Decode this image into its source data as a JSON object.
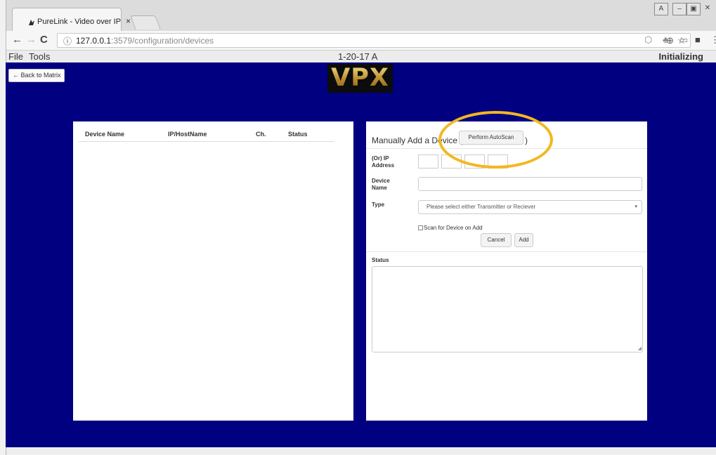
{
  "browser": {
    "tab_title": "PureLink - Video over IP",
    "tab_close": "×",
    "url_host": "127.0.0.1",
    "url_rest": ":3579/configuration/devices",
    "info_icon": "info-icon",
    "window_controls": [
      "A",
      "–",
      "▣",
      "✕"
    ]
  },
  "app": {
    "menu": [
      "File",
      "Tools"
    ],
    "version": "1-20-17 A",
    "state": "Initializing",
    "back_button": "← Back to Matrix",
    "logo": "VPX"
  },
  "device_list": {
    "columns": [
      "Device Name",
      "IP/HostName",
      "Ch.",
      "Status"
    ],
    "rows": []
  },
  "add_device": {
    "title": "Manually Add a Device (Or",
    "autoscan_button": "Perform AutoScan",
    "title_close": ")",
    "ip_label_1": "(Or) IP",
    "ip_label_2": "Address",
    "ip_octets": [
      "",
      "",
      "",
      ""
    ],
    "name_label_1": "Device",
    "name_label_2": "Name",
    "name_value": "",
    "type_label": "Type",
    "type_selected": "Please select either Transmitter or Reciever",
    "scan_checkbox_label": "Scan for Device on Add",
    "cancel_button": "Cancel",
    "add_button": "Add",
    "status_label": "Status",
    "status_text": ""
  },
  "colors": {
    "content_bg": "#000080",
    "highlight": "#f2b821"
  }
}
